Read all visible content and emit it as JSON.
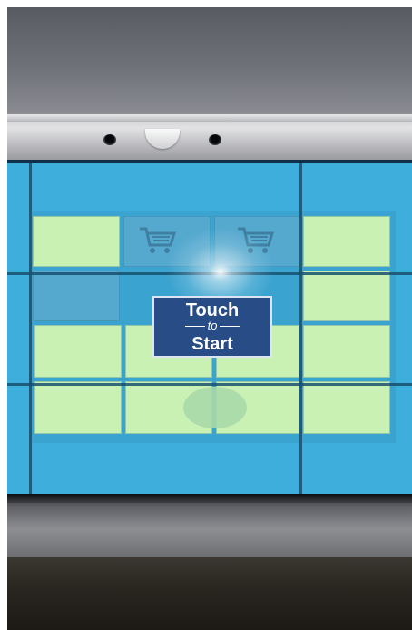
{
  "kiosk": {
    "start_button": {
      "line1": "Touch",
      "line2": "to",
      "line3": "Start"
    },
    "icons": [
      "cart-icon",
      "cart-icon"
    ],
    "colors": {
      "screen_blue": "#3eaedd",
      "tile_green": "#c9f1b4",
      "button_navy": "#274c86"
    }
  }
}
